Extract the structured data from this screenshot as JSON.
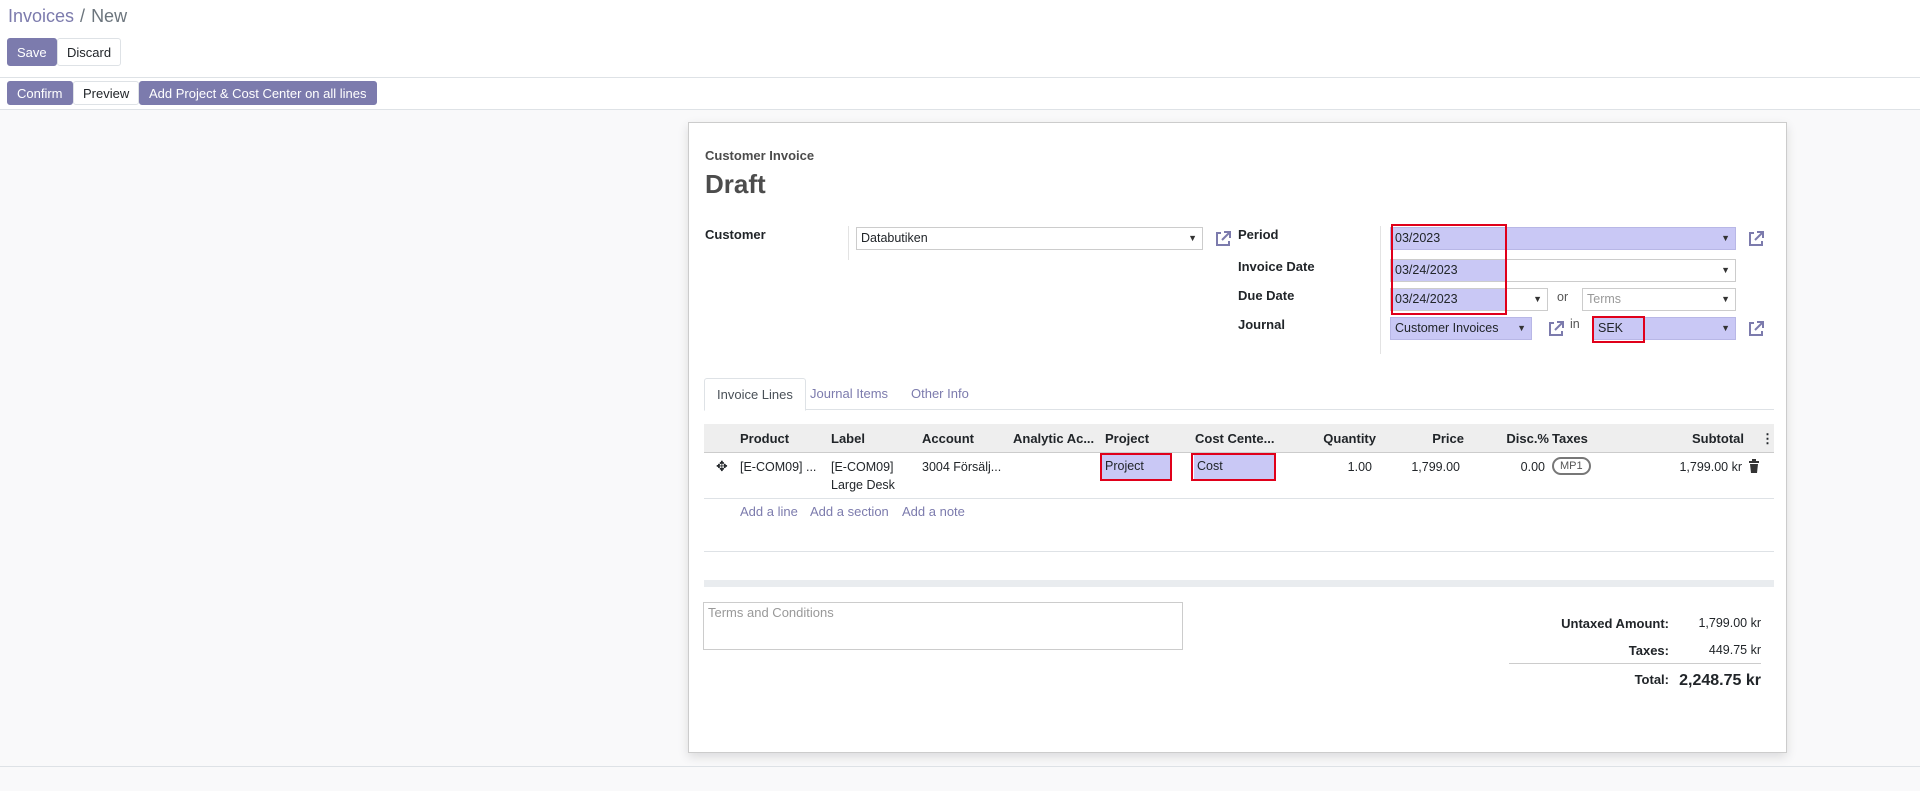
{
  "breadcrumb": {
    "parent": "Invoices",
    "separator": "/",
    "current": "New"
  },
  "toolbar": {
    "save_label": "Save",
    "discard_label": "Discard"
  },
  "status_bar": {
    "confirm_label": "Confirm",
    "preview_label": "Preview",
    "add_project_label": "Add Project & Cost Center on all lines"
  },
  "sheet": {
    "doc_type": "Customer Invoice",
    "title": "Draft",
    "customer": {
      "label": "Customer",
      "value": "Databutiken"
    },
    "period": {
      "label": "Period",
      "value": "03/2023"
    },
    "invoice_date": {
      "label": "Invoice Date",
      "value": "03/24/2023"
    },
    "due_date": {
      "label": "Due Date",
      "value": "03/24/2023",
      "or_text": "or",
      "terms_placeholder": "Terms"
    },
    "journal": {
      "label": "Journal",
      "value": "Customer Invoices",
      "in_text": "in",
      "currency": "SEK"
    }
  },
  "tabs": [
    {
      "label": "Invoice Lines",
      "active": true
    },
    {
      "label": "Journal Items",
      "active": false
    },
    {
      "label": "Other Info",
      "active": false
    }
  ],
  "lines_table": {
    "headers": [
      "Product",
      "Label",
      "Account",
      "Analytic Ac...",
      "Project",
      "Cost Cente...",
      "Quantity",
      "Price",
      "Disc.%",
      "Taxes",
      "Subtotal"
    ],
    "rows": [
      {
        "product": "[E-COM09] ...",
        "label_line1": "[E-COM09]",
        "label_line2": "Large Desk",
        "account": "3004 Försälj...",
        "analytic": "",
        "project": "Project",
        "cost_center": "Cost",
        "quantity": "1.00",
        "price": "1,799.00",
        "discount": "0.00",
        "tax": "MP1",
        "subtotal": "1,799.00 kr"
      }
    ],
    "add_line": "Add a line",
    "add_section": "Add a section",
    "add_note": "Add a note"
  },
  "terms_placeholder": "Terms and Conditions",
  "totals": {
    "untaxed_label": "Untaxed Amount:",
    "untaxed_value": "1,799.00 kr",
    "taxes_label": "Taxes:",
    "taxes_value": "449.75 kr",
    "total_label": "Total:",
    "total_value": "2,248.75 kr"
  },
  "icons": [
    "external-link-icon",
    "move-handle-icon",
    "trash-icon",
    "kebab-menu-icon",
    "caret-down-icon"
  ],
  "colors": {
    "primary": "#7c7bad",
    "highlight": "#c9c8f5",
    "annotation_red": "#e0001a"
  }
}
